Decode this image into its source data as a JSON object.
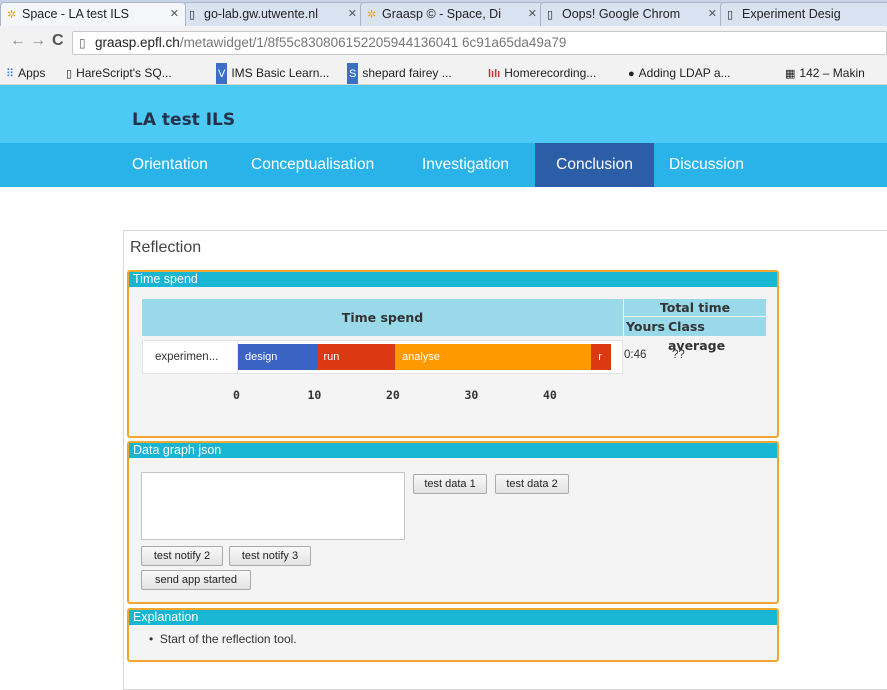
{
  "browser": {
    "tabs": [
      {
        "label": "Space - LA test ILS",
        "icon": "graasp-icon",
        "active": true
      },
      {
        "label": "go-lab.gw.utwente.nl",
        "icon": "page-icon",
        "active": false
      },
      {
        "label": "Graasp © - Space, Di",
        "icon": "graasp-icon",
        "active": false
      },
      {
        "label": "Oops! Google Chrom",
        "icon": "page-icon",
        "active": false
      },
      {
        "label": "Experiment Desig",
        "icon": "page-icon",
        "active": false
      }
    ],
    "url_host": "graasp.epfl.ch",
    "url_path": "/metawidget/1/8f55c830806152205944136041 6c91a65da49a79",
    "bookmarks": [
      {
        "label": "Apps",
        "icon": "apps-grid-icon"
      },
      {
        "label": "HareScript's SQ...",
        "icon": "page-icon"
      },
      {
        "label": "IMS Basic Learn...",
        "icon": "v-logo-icon"
      },
      {
        "label": "shepard fairey ...",
        "icon": "s-logo-icon"
      },
      {
        "label": "Homerecording...",
        "icon": "bars-logo-icon"
      },
      {
        "label": "Adding LDAP a...",
        "icon": "ut-logo-icon"
      },
      {
        "label": "142 – Makin",
        "icon": "grid-logo-icon"
      }
    ]
  },
  "app": {
    "title": "LA test ILS",
    "phases": [
      {
        "label": "Orientation",
        "active": false
      },
      {
        "label": "Conceptualisation",
        "active": false
      },
      {
        "label": "Investigation",
        "active": false
      },
      {
        "label": "Conclusion",
        "active": true
      },
      {
        "label": "Discussion",
        "active": false
      }
    ]
  },
  "reflection": {
    "title": "Reflection",
    "time_spend": {
      "panel_title": "Time spend",
      "column_title": "Time spend",
      "total_title": "Total time",
      "yours_label": "Yours",
      "class_label": "Class average",
      "rows": [
        {
          "label": "experimen...",
          "yours": "0:46",
          "class_average": "??",
          "segments": [
            {
              "label": "design",
              "start": 0,
              "end": 10,
              "color": "#3b63c4"
            },
            {
              "label": "run",
              "start": 10,
              "end": 20,
              "color": "#dc3912"
            },
            {
              "label": "analyse",
              "start": 20,
              "end": 45,
              "color": "#ff9900"
            },
            {
              "label": "r",
              "start": 45,
              "end": 47.5,
              "color": "#dc3912"
            }
          ]
        }
      ],
      "axis_ticks": [
        "0",
        "10",
        "20",
        "30",
        "40"
      ]
    },
    "data_graph": {
      "panel_title": "Data graph json",
      "json_value": "",
      "buttons": {
        "test_data_1": "test data 1",
        "test_data_2": "test data 2",
        "test_notify_2": "test notify 2",
        "test_notify_3": "test notify 3",
        "send_app_started": "send app started"
      }
    },
    "explanation": {
      "panel_title": "Explanation",
      "items": [
        "Start of the reflection tool."
      ]
    }
  },
  "colors": {
    "header_bg": "#4dc9f5",
    "phase_bar_bg": "#2ab3e8",
    "phase_active_bg": "#2c5ea8",
    "panel_border": "#f0a830",
    "panel_head_bg": "#19b6d4"
  }
}
